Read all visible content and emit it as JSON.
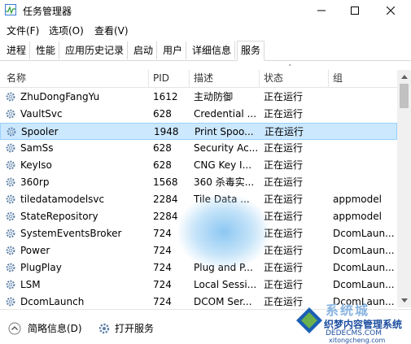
{
  "window": {
    "title": "任务管理器"
  },
  "menu": [
    "文件(F)",
    "选项(O)",
    "查看(V)"
  ],
  "tabs": [
    "进程",
    "性能",
    "应用历史记录",
    "启动",
    "用户",
    "详细信息",
    "服务"
  ],
  "active_tab": "服务",
  "columns": {
    "name": "名称",
    "pid": "PID",
    "desc": "描述",
    "status": "状态",
    "group": "组"
  },
  "rows": [
    {
      "name": "ZhuDongFangYu",
      "pid": "1612",
      "desc": "主动防御",
      "status": "正在运行",
      "group": ""
    },
    {
      "name": "VaultSvc",
      "pid": "628",
      "desc": "Credential ...",
      "status": "正在运行",
      "group": ""
    },
    {
      "name": "Spooler",
      "pid": "1948",
      "desc": "Print Spoo...",
      "status": "正在运行",
      "group": ""
    },
    {
      "name": "SamSs",
      "pid": "628",
      "desc": "Security Ac...",
      "status": "正在运行",
      "group": ""
    },
    {
      "name": "KeyIso",
      "pid": "628",
      "desc": "CNG Key I...",
      "status": "正在运行",
      "group": ""
    },
    {
      "name": "360rp",
      "pid": "1568",
      "desc": "360 杀毒实...",
      "status": "正在运行",
      "group": ""
    },
    {
      "name": "tiledatamodelsvc",
      "pid": "2284",
      "desc": "Tile Data ...",
      "status": "正在运行",
      "group": "appmodel"
    },
    {
      "name": "StateRepository",
      "pid": "2284",
      "desc": "",
      "status": "正在运行",
      "group": "appmodel"
    },
    {
      "name": "SystemEventsBroker",
      "pid": "724",
      "desc": "",
      "status": "正在运行",
      "group": "DcomLaun..."
    },
    {
      "name": "Power",
      "pid": "724",
      "desc": "",
      "status": "正在运行",
      "group": "DcomLaun..."
    },
    {
      "name": "PlugPlay",
      "pid": "724",
      "desc": "Plug and P...",
      "status": "正在运行",
      "group": "DcomLaun..."
    },
    {
      "name": "LSM",
      "pid": "724",
      "desc": "Local Sessi...",
      "status": "正在运行",
      "group": "DcomLaun..."
    },
    {
      "name": "DcomLaunch",
      "pid": "724",
      "desc": "DCOM Ser...",
      "status": "正在运行",
      "group": "DcomLaun..."
    }
  ],
  "selected_row": 2,
  "footer": {
    "summary": "简略信息(D)",
    "open_services": "打开服务"
  },
  "watermark": {
    "line1": "织梦内容管理系统",
    "line2": "DEDECMS.COM",
    "line3": "xitongcheng.com",
    "brand": "系统城"
  },
  "colors": {
    "selection": "#cce8ff",
    "selection_border": "#99d1ff",
    "gear": "#5b7fa6"
  }
}
